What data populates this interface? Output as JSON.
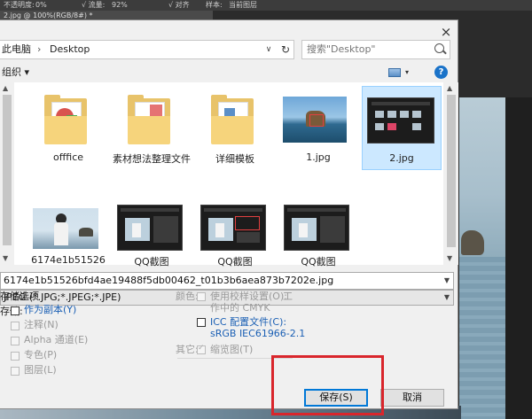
{
  "ps": {
    "toolbar": [
      "不透明度:",
      "0%",
      "√ 流量:",
      "92%",
      "√ 对齐",
      "样本:",
      "当前图层"
    ],
    "doc_tab": "2.jpg @ 100%(RGB/8#) *"
  },
  "dialog": {
    "close": "×",
    "address": {
      "crumb1": "此电脑",
      "sep": "›",
      "crumb2": "Desktop",
      "dd": "∨",
      "refresh": "↻"
    },
    "search": {
      "placeholder": "搜索\"Desktop\""
    },
    "toolbar": {
      "organize": "组织 ▾",
      "help": "?",
      "view_dd": "▾"
    },
    "files": [
      {
        "label": "offfice",
        "kind": "folder-office"
      },
      {
        "label": "素材想法整理文件",
        "kind": "folder-docs"
      },
      {
        "label": "详细模板",
        "kind": "folder-template"
      },
      {
        "label": "1.jpg",
        "kind": "photo-sky"
      },
      {
        "label": "2.jpg",
        "kind": "photo-dark",
        "selected": true
      },
      {
        "label": "6174e1b51526",
        "kind": "photo-girl"
      },
      {
        "label": "QQ截图",
        "kind": "photo-dark"
      },
      {
        "label": "QQ截图",
        "kind": "photo-dark"
      },
      {
        "label": "QQ截图",
        "kind": "photo-dark"
      }
    ],
    "filename": "6174e1b51526bfd4ae19488f5db00462_t01b3b6aea873b7202e.jpg",
    "filetype": "JPEG (*.JPG;*.JPEG;*.JPE)",
    "save_options": {
      "title": "存储选项",
      "save_label": "存储:",
      "as_copy": "作为副本(Y)",
      "notes": "注释(N)",
      "alpha": "Alpha 通道(E)",
      "spot": "专色(P)",
      "layers": "图层(L)"
    },
    "color": {
      "label": "颜色:",
      "proof": "使用校样设置(O):",
      "proof_value": "工",
      "proof_value2": "作中的 CMYK",
      "icc": "ICC 配置文件(C):",
      "icc_value": "sRGB IEC61966-2.1"
    },
    "other": {
      "label": "其它:",
      "thumbnail": "缩览图(T)"
    },
    "buttons": {
      "save": "保存(S)",
      "cancel": "取消"
    }
  },
  "colors": {
    "highlight": "#d9262c",
    "accent": "#1a5fb4",
    "selected_bg": "#cce8ff"
  }
}
